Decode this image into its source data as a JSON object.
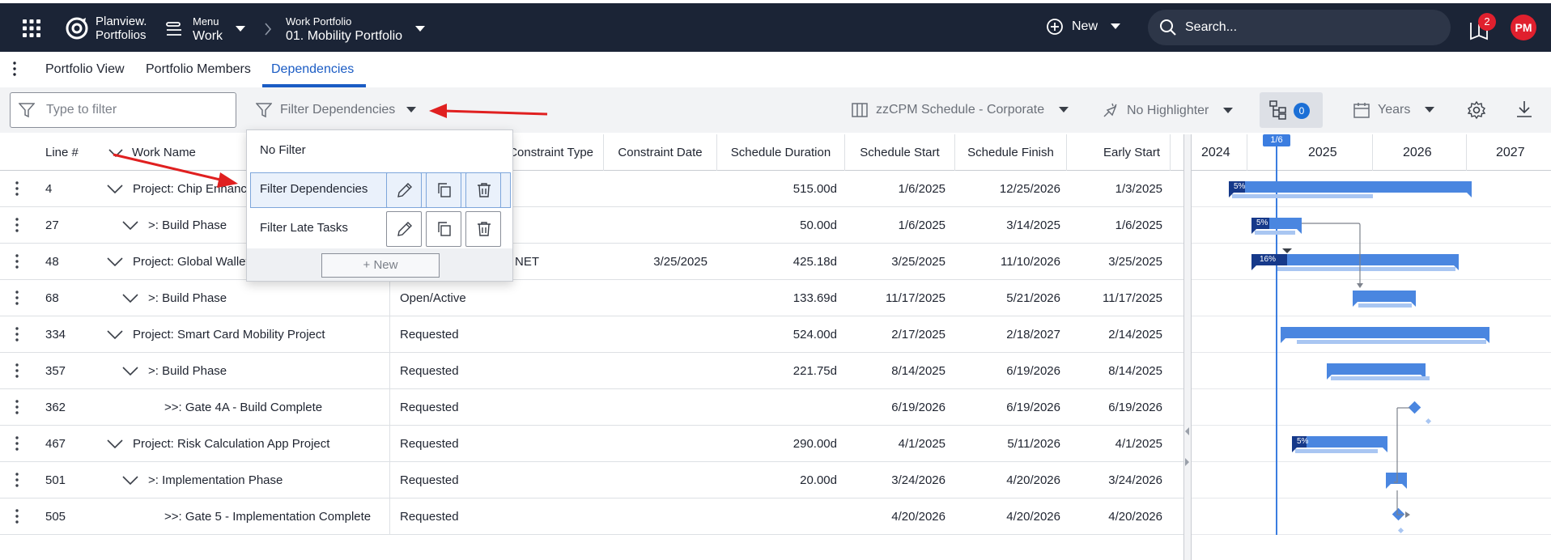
{
  "app": {
    "logo_line1": "Planview.",
    "logo_line2": "Portfolios",
    "menu_small": "Menu",
    "menu_big": "Work",
    "wp_small": "Work Portfolio",
    "wp_big": "01. Mobility Portfolio",
    "new_label": "New",
    "search_placeholder": "Search...",
    "notification_count": "2",
    "avatar_initials": "PM"
  },
  "tabs": [
    {
      "label": "Portfolio View"
    },
    {
      "label": "Portfolio Members"
    },
    {
      "label": "Dependencies"
    }
  ],
  "toolbar": {
    "filter_placeholder": "Type to filter",
    "filter_dependencies": "Filter Dependencies",
    "schedule": "zzCPM Schedule - Corporate",
    "highlighter": "No Highlighter",
    "dependency_count": "0",
    "timescale": "Years"
  },
  "columns": {
    "line": "Line #",
    "work_name": "Work Name",
    "constraint_type": "Constraint Type",
    "constraint_date": "Constraint Date",
    "schedule_duration": "Schedule Duration",
    "schedule_start": "Schedule Start",
    "schedule_finish": "Schedule Finish",
    "early_start": "Early Start"
  },
  "rows": [
    {
      "line": "4",
      "name": "Project: Chip Enhancement",
      "status": "",
      "constraint_type": "",
      "constraint_date": "",
      "duration": "515.00d",
      "start": "1/6/2025",
      "finish": "12/25/2026",
      "early_start": "1/3/2025"
    },
    {
      "line": "27",
      "name": ">: Build Phase",
      "status": "",
      "constraint_type": "",
      "constraint_date": "",
      "duration": "50.00d",
      "start": "1/6/2025",
      "finish": "3/14/2025",
      "early_start": "1/6/2025"
    },
    {
      "line": "48",
      "name": "Project: Global Wallet",
      "status": "",
      "constraint_type": "NET",
      "constraint_date": "3/25/2025",
      "duration": "425.18d",
      "start": "3/25/2025",
      "finish": "11/10/2026",
      "early_start": "3/25/2025"
    },
    {
      "line": "68",
      "name": ">: Build Phase",
      "status": "Open/Active",
      "constraint_type": "",
      "constraint_date": "",
      "duration": "133.69d",
      "start": "11/17/2025",
      "finish": "5/21/2026",
      "early_start": "11/17/2025"
    },
    {
      "line": "334",
      "name": "Project: Smart Card Mobility Project",
      "status": "Requested",
      "constraint_type": "",
      "constraint_date": "",
      "duration": "524.00d",
      "start": "2/17/2025",
      "finish": "2/18/2027",
      "early_start": "2/14/2025"
    },
    {
      "line": "357",
      "name": ">: Build Phase",
      "status": "Requested",
      "constraint_type": "",
      "constraint_date": "",
      "duration": "221.75d",
      "start": "8/14/2025",
      "finish": "6/19/2026",
      "early_start": "8/14/2025"
    },
    {
      "line": "362",
      "name": ">>: Gate 4A - Build Complete",
      "status": "Requested",
      "constraint_type": "",
      "constraint_date": "",
      "duration": "",
      "start": "6/19/2026",
      "finish": "6/19/2026",
      "early_start": "6/19/2026"
    },
    {
      "line": "467",
      "name": "Project: Risk Calculation App Project",
      "status": "Requested",
      "constraint_type": "",
      "constraint_date": "",
      "duration": "290.00d",
      "start": "4/1/2025",
      "finish": "5/11/2026",
      "early_start": "4/1/2025"
    },
    {
      "line": "501",
      "name": ">: Implementation Phase",
      "status": "Requested",
      "constraint_type": "",
      "constraint_date": "",
      "duration": "20.00d",
      "start": "3/24/2026",
      "finish": "4/20/2026",
      "early_start": "3/24/2026"
    },
    {
      "line": "505",
      "name": ">>: Gate 5 - Implementation Complete",
      "status": "Requested",
      "constraint_type": "",
      "constraint_date": "",
      "duration": "",
      "start": "4/20/2026",
      "finish": "4/20/2026",
      "early_start": "4/20/2026"
    }
  ],
  "gantt": {
    "years": [
      "2024",
      "2025",
      "2026",
      "2027"
    ],
    "today_label": "1/6",
    "progress_labels": [
      "5%",
      "5%",
      "16%",
      "5%"
    ]
  },
  "popup": {
    "no_filter": "No Filter",
    "filter_1": "Filter Dependencies",
    "filter_2": "Filter Late Tasks",
    "new_label": "+ New"
  },
  "colors": {
    "topbar_bg": "#1b2436",
    "accent": "#1b5cc4",
    "bar": "#4a86e0",
    "bar_progress": "#16398a",
    "baseline": "#a9c6f2",
    "badge": "#e0202e",
    "annotation_arrow": "#e02020"
  }
}
